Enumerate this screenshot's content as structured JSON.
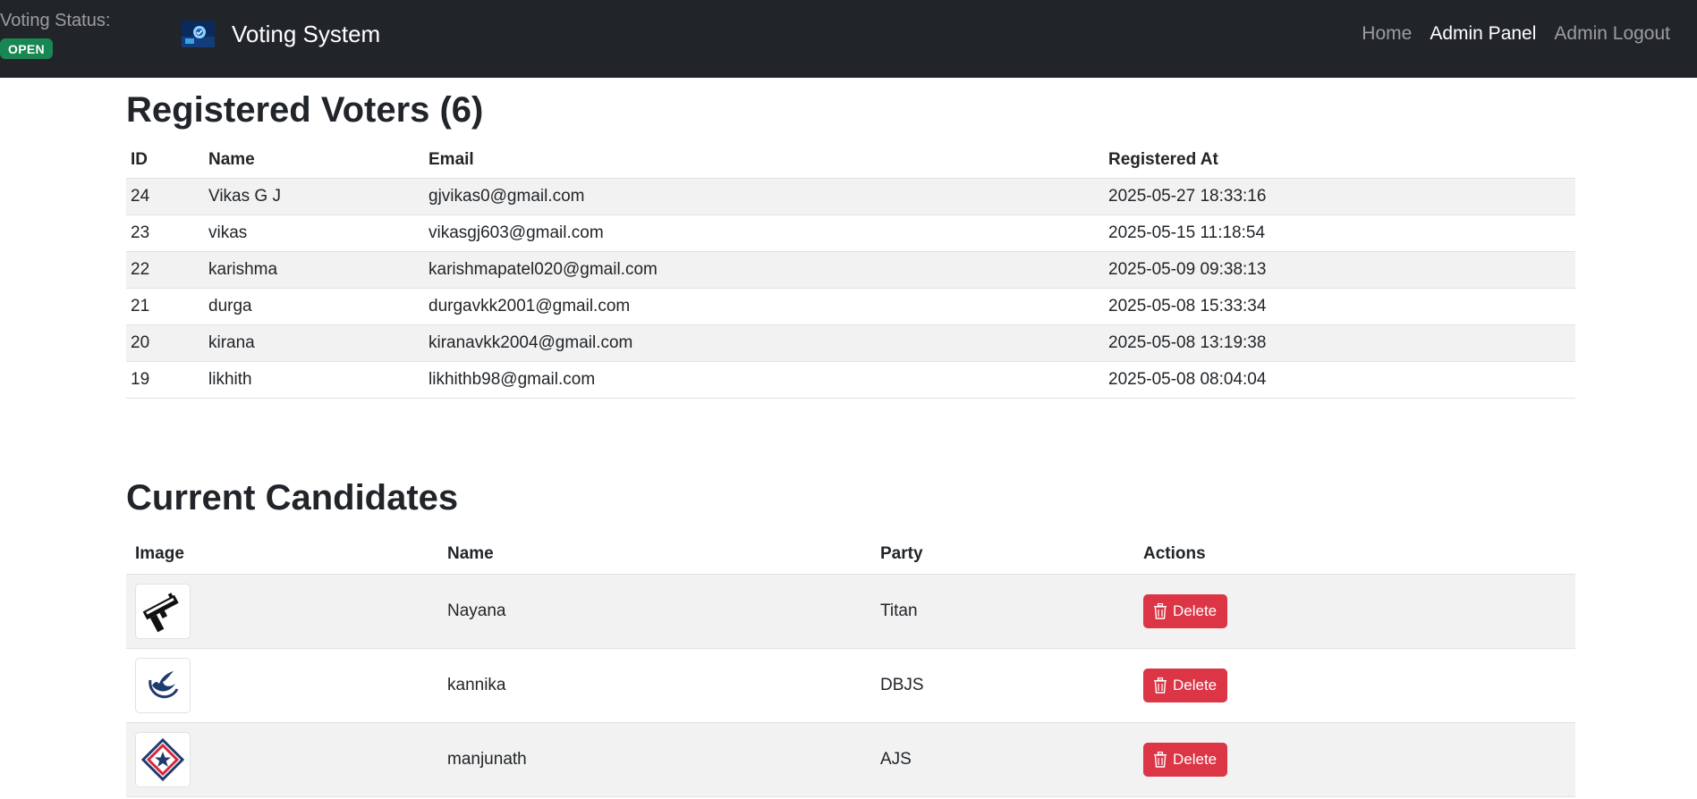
{
  "navbar": {
    "status_label": "Voting Status:",
    "status_value": "OPEN",
    "brand": "Voting System",
    "brand_logo_icon": "voting-logo-icon",
    "links": [
      {
        "label": "Home",
        "active": false
      },
      {
        "label": "Admin Panel",
        "active": true
      },
      {
        "label": "Admin Logout",
        "active": false
      }
    ]
  },
  "voters": {
    "title": "Registered Voters (6)",
    "columns": [
      "ID",
      "Name",
      "Email",
      "Registered At"
    ],
    "rows": [
      {
        "id": "24",
        "name": "Vikas G J",
        "email": "gjvikas0@gmail.com",
        "registered_at": "2025-05-27 18:33:16"
      },
      {
        "id": "23",
        "name": "vikas",
        "email": "vikasgj603@gmail.com",
        "registered_at": "2025-05-15 11:18:54"
      },
      {
        "id": "22",
        "name": "karishma",
        "email": "karishmapatel020@gmail.com",
        "registered_at": "2025-05-09 09:38:13"
      },
      {
        "id": "21",
        "name": "durga",
        "email": "durgavkk2001@gmail.com",
        "registered_at": "2025-05-08 15:33:34"
      },
      {
        "id": "20",
        "name": "kirana",
        "email": "kiranavkk2004@gmail.com",
        "registered_at": "2025-05-08 13:19:38"
      },
      {
        "id": "19",
        "name": "likhith",
        "email": "likhithb98@gmail.com",
        "registered_at": "2025-05-08 08:04:04"
      }
    ]
  },
  "candidates": {
    "title": "Current Candidates",
    "columns": [
      "Image",
      "Name",
      "Party",
      "Actions"
    ],
    "delete_label": "Delete",
    "rows": [
      {
        "name": "Nayana",
        "party": "Titan",
        "symbol_icon": "gun-symbol-icon"
      },
      {
        "name": "kannika",
        "party": "DBJS",
        "symbol_icon": "bird-symbol-icon"
      },
      {
        "name": "manjunath",
        "party": "AJS",
        "symbol_icon": "star-diamond-symbol-icon"
      }
    ]
  },
  "colors": {
    "navbar_bg": "#212529",
    "status_open": "#198754",
    "delete_button": "#dc3545",
    "stripe": "#f2f2f2"
  }
}
